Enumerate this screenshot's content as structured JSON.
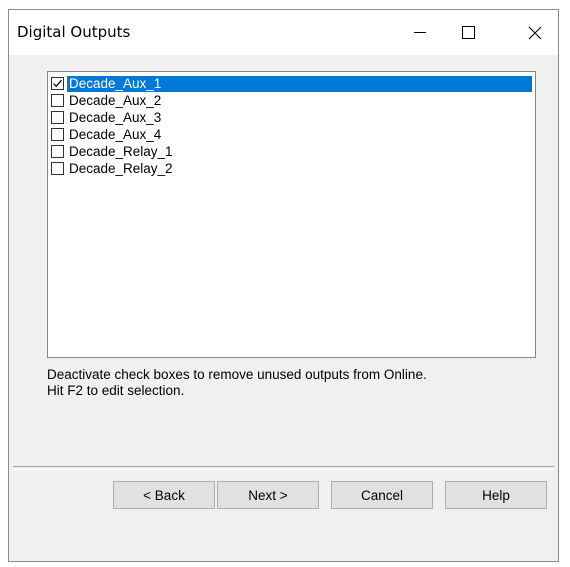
{
  "window": {
    "title": "Digital Outputs"
  },
  "outputs": {
    "items": [
      {
        "label": "Decade_Aux_1",
        "checked": true,
        "selected": true
      },
      {
        "label": "Decade_Aux_2",
        "checked": false,
        "selected": false
      },
      {
        "label": "Decade_Aux_3",
        "checked": false,
        "selected": false
      },
      {
        "label": "Decade_Aux_4",
        "checked": false,
        "selected": false
      },
      {
        "label": "Decade_Relay_1",
        "checked": false,
        "selected": false
      },
      {
        "label": "Decade_Relay_2",
        "checked": false,
        "selected": false
      }
    ]
  },
  "hint": {
    "line1": "Deactivate check boxes to remove unused outputs from Online.",
    "line2": "Hit F2 to edit selection."
  },
  "buttons": {
    "back": "< Back",
    "next": "Next >",
    "cancel": "Cancel",
    "help": "Help"
  },
  "colors": {
    "selection": "#0078d7",
    "dialog_bg": "#f0f0f0"
  }
}
